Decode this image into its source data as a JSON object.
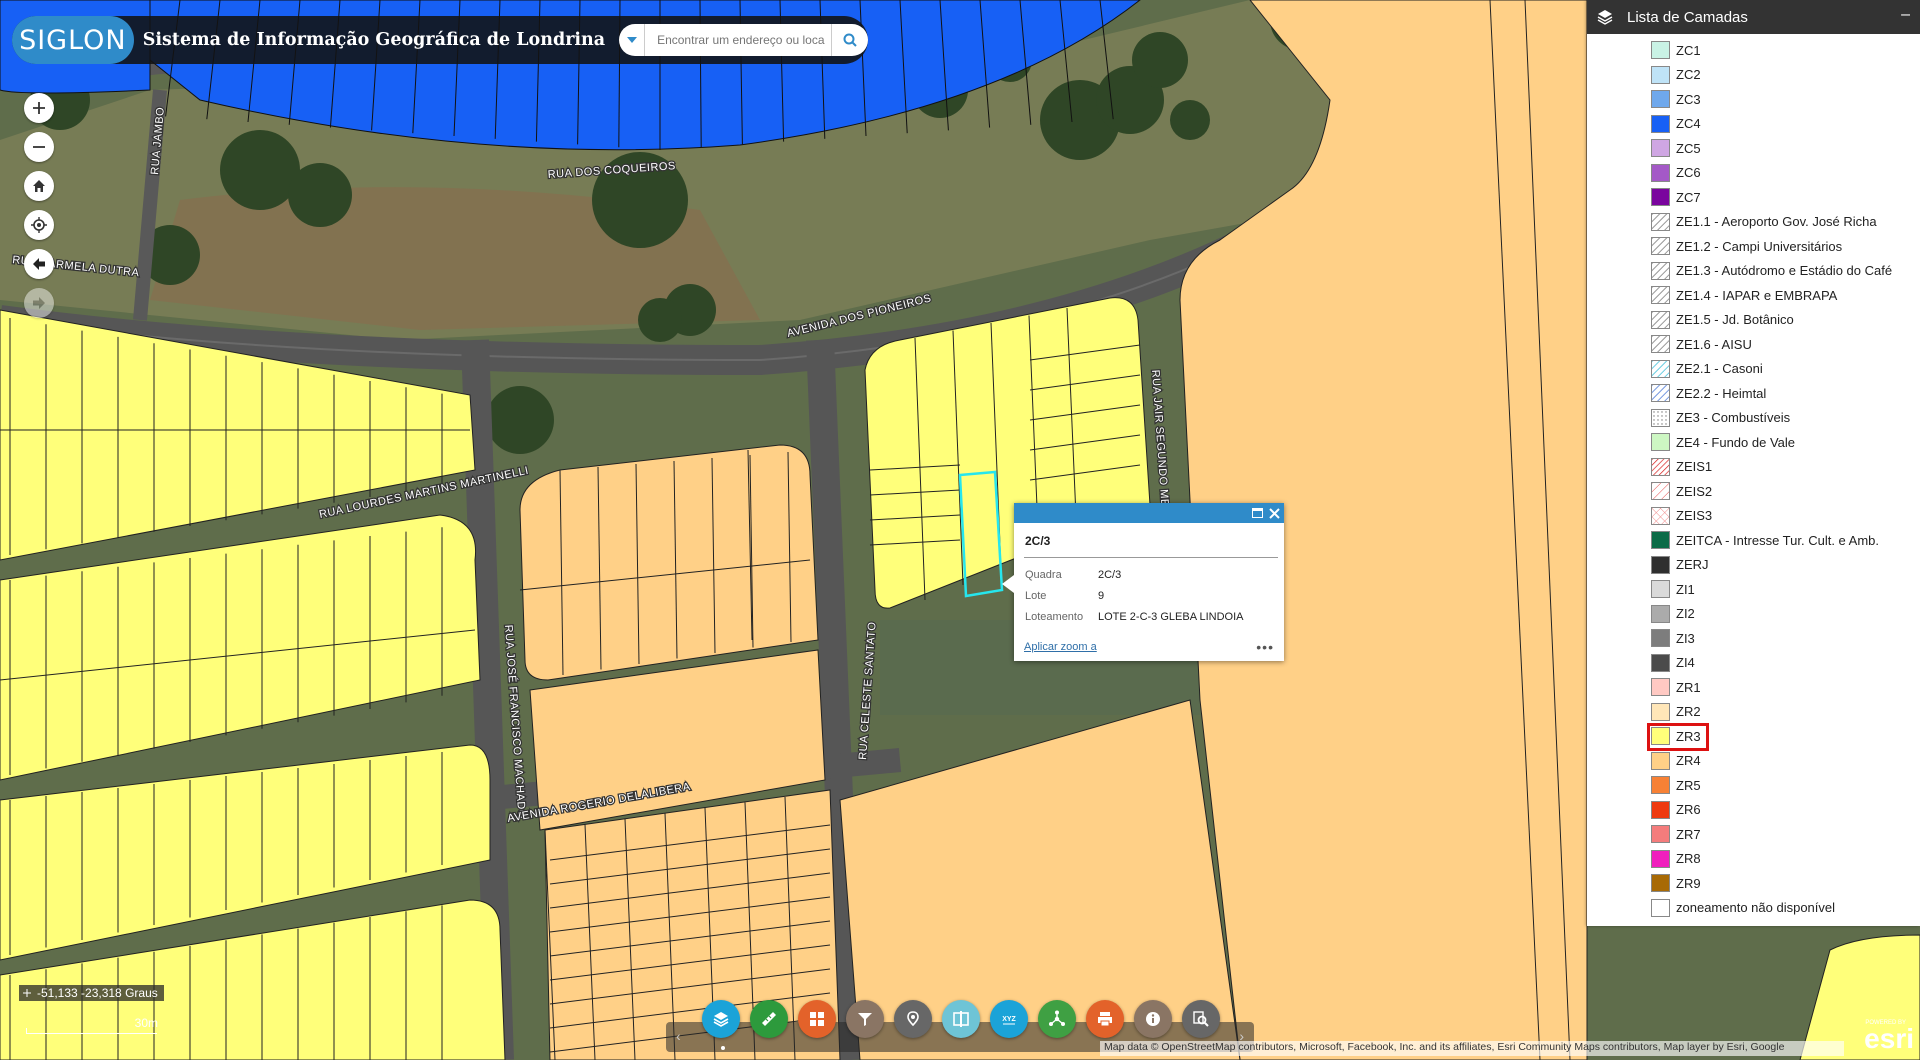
{
  "app": {
    "logo_text": "SIGLON",
    "title": "Sistema de Informação Geográfica de Londrina"
  },
  "search": {
    "placeholder": "Encontrar um endereço ou loca"
  },
  "map_labels": {
    "rua_jambo": "RUA JAMBO",
    "rua_coqueiros": "RUA DOS COQUEIROS",
    "rua_carmela": "RUA CARMELA DUTRA",
    "av_pioneiros": "AVENIDA DOS PIONEIROS",
    "rua_jair": "RUA JAIR SEGUNDO MEN",
    "rua_lourdes": "RUA LOURDES MARTINS MARTINELLI",
    "rua_jose": "RUA JOSÉ FRANCISCO MACHADO",
    "rua_celeste": "RUA CELESTE SANTATO",
    "av_rogerio": "AVENIDA ROGERIO DELALIBERA"
  },
  "layer_panel": {
    "title": "Lista de Camadas",
    "items": [
      {
        "label": "ZC1",
        "color": "#c9f2e5"
      },
      {
        "label": "ZC2",
        "color": "#bfe3f7"
      },
      {
        "label": "ZC3",
        "color": "#6fa8ec"
      },
      {
        "label": "ZC4",
        "color": "#1760f5"
      },
      {
        "label": "ZC5",
        "color": "#cfa6e3"
      },
      {
        "label": "ZC6",
        "color": "#a459c7"
      },
      {
        "label": "ZC7",
        "color": "#7a059e"
      },
      {
        "label": "ZE1.1 - Aeroporto Gov. José Richa",
        "color": "hatch-gray"
      },
      {
        "label": "ZE1.2 - Campi Universitários",
        "color": "hatch-gray"
      },
      {
        "label": "ZE1.3 - Autódromo e Estádio do Café",
        "color": "hatch-gray"
      },
      {
        "label": "ZE1.4 - IAPAR e EMBRAPA",
        "color": "hatch-gray"
      },
      {
        "label": "ZE1.5 - Jd. Botânico",
        "color": "hatch-gray"
      },
      {
        "label": "ZE1.6 - AISU",
        "color": "hatch-gray"
      },
      {
        "label": "ZE2.1 - Casoni",
        "color": "hatch-cyan"
      },
      {
        "label": "ZE2.2 - Heimtal",
        "color": "hatch-blue"
      },
      {
        "label": "ZE3 - Combustíveis",
        "color": "dots"
      },
      {
        "label": "ZE4 - Fundo de Vale",
        "color": "#cdf7c3"
      },
      {
        "label": "ZEIS1",
        "color": "hatch-red"
      },
      {
        "label": "ZEIS2",
        "color": "hatch-red2"
      },
      {
        "label": "ZEIS3",
        "color": "cross-red"
      },
      {
        "label": "ZEITCA - Intresse Tur. Cult. e Amb.",
        "color": "#0c6b47"
      },
      {
        "label": "ZERJ",
        "color": "#2f2f2f"
      },
      {
        "label": "ZI1",
        "color": "#dadada"
      },
      {
        "label": "ZI2",
        "color": "#ababab"
      },
      {
        "label": "ZI3",
        "color": "#7d7d7d"
      },
      {
        "label": "ZI4",
        "color": "#4b4b4b"
      },
      {
        "label": "ZR1",
        "color": "#ffc9c3"
      },
      {
        "label": "ZR2",
        "color": "#ffe6b8"
      },
      {
        "label": "ZR3",
        "color": "#ffff7a"
      },
      {
        "label": "ZR4",
        "color": "#ffd087"
      },
      {
        "label": "ZR5",
        "color": "#f78135"
      },
      {
        "label": "ZR6",
        "color": "#ee3a10"
      },
      {
        "label": "ZR7",
        "color": "#f47c7c"
      },
      {
        "label": "ZR8",
        "color": "#f01fbd"
      },
      {
        "label": "ZR9",
        "color": "#a86a05"
      },
      {
        "label": "zoneamento não disponível",
        "color": "#ffffff"
      }
    ],
    "highlighted": "ZR3"
  },
  "popup": {
    "title": "2C/3",
    "rows": [
      {
        "key": "Quadra",
        "value": "2C/3"
      },
      {
        "key": "Lote",
        "value": "9"
      },
      {
        "key": "Loteamento",
        "value": "LOTE 2-C-3 GLEBA LINDOIA"
      }
    ],
    "zoom_link": "Aplicar zoom a",
    "more": "•••"
  },
  "coords": {
    "text": "-51,133 -23,318 Graus"
  },
  "scale": {
    "label": "30m"
  },
  "toolbar": {
    "buttons": [
      {
        "name": "layers-icon",
        "color": "#1ba3d8"
      },
      {
        "name": "measure-icon",
        "color": "#2d9a3c"
      },
      {
        "name": "basemap-grid-icon",
        "color": "#e3622a"
      },
      {
        "name": "filter-icon",
        "color": "#8a7564"
      },
      {
        "name": "locate-pin-icon",
        "color": "#676767"
      },
      {
        "name": "swipe-icon",
        "color": "#6ec4d6"
      },
      {
        "name": "xyz-coordinates-icon",
        "color": "#1ba3d8"
      },
      {
        "name": "share-icon",
        "color": "#3fa043"
      },
      {
        "name": "print-icon",
        "color": "#e3622a"
      },
      {
        "name": "info-icon",
        "color": "#8a7564"
      },
      {
        "name": "query-search-icon",
        "color": "#676767"
      }
    ]
  },
  "attribution": "Map data © OpenStreetMap contributors, Microsoft, Facebook, Inc. and its affiliates, Esri Community Maps contributors, Map layer by Esri, Google",
  "esri": {
    "logo": "esri",
    "powered": "POWERED BY"
  }
}
